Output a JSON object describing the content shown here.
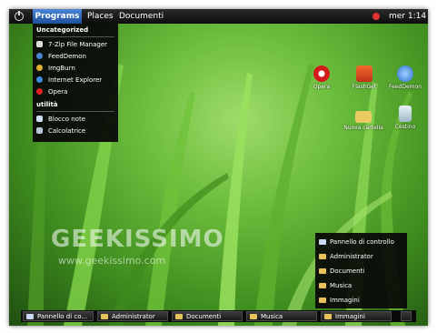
{
  "top_bar": {
    "menus": [
      "Programs",
      "Places",
      "Documenti"
    ],
    "clock": "mer 1:14"
  },
  "programs_menu": {
    "section_uncategorized": "Uncategorized",
    "items_uncategorized": [
      "7-Zip File Manager",
      "FeedDemon",
      "ImgBurn",
      "Internet Explorer",
      "Opera"
    ],
    "section_utilita": "utilità",
    "items_utilita": [
      "Blocco note",
      "Calcolatrice"
    ]
  },
  "desktop_icons": [
    "Opera",
    "FlashGet",
    "FeedDemon",
    "Nuova cartella",
    "Cestino"
  ],
  "places_menu": {
    "items": [
      "Pannello di controllo",
      "Administrator",
      "Documenti",
      "Musica",
      "Immagini"
    ]
  },
  "taskbar": {
    "items": [
      "Pannello di co...",
      "Administrator",
      "Documenti",
      "Musica",
      "Immagini"
    ]
  },
  "watermark": {
    "logo": "GEEKISSIMO",
    "url": "www.geekissimo.com"
  },
  "colors": {
    "menu_highlight": "#2f68c0",
    "menu_background": "#0c0c0c",
    "folder": "#e9c35a"
  }
}
